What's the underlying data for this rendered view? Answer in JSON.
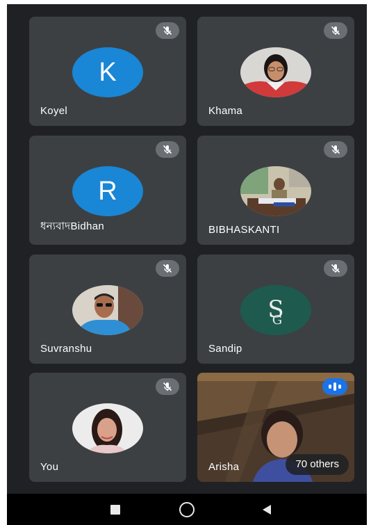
{
  "participants": [
    {
      "name": "Koyel",
      "initial": "K",
      "muted": true
    },
    {
      "name": "Khama",
      "muted": true
    },
    {
      "name": "ধন্যবাদBidhan",
      "initial": "R",
      "muted": true
    },
    {
      "name": "BIBHASKANTI",
      "muted": true
    },
    {
      "name": "Suvranshu",
      "muted": true
    },
    {
      "name": "Sandip",
      "initial": "SG",
      "muted": true
    },
    {
      "name": "You",
      "muted": true
    },
    {
      "name": "Arisha",
      "speaking": true
    }
  ],
  "others_label": "70 others",
  "colors": {
    "background": "#202124",
    "tile": "#3c4043",
    "avatar_blue": "#1a86d6",
    "avatar_green": "#1f5a4f",
    "speaking_blue": "#1a73e8"
  },
  "icons": {
    "muted": "mic-off-icon",
    "speaking": "audio-wave-icon",
    "nav_recent": "square-icon",
    "nav_home": "circle-icon",
    "nav_back": "triangle-back-icon"
  }
}
